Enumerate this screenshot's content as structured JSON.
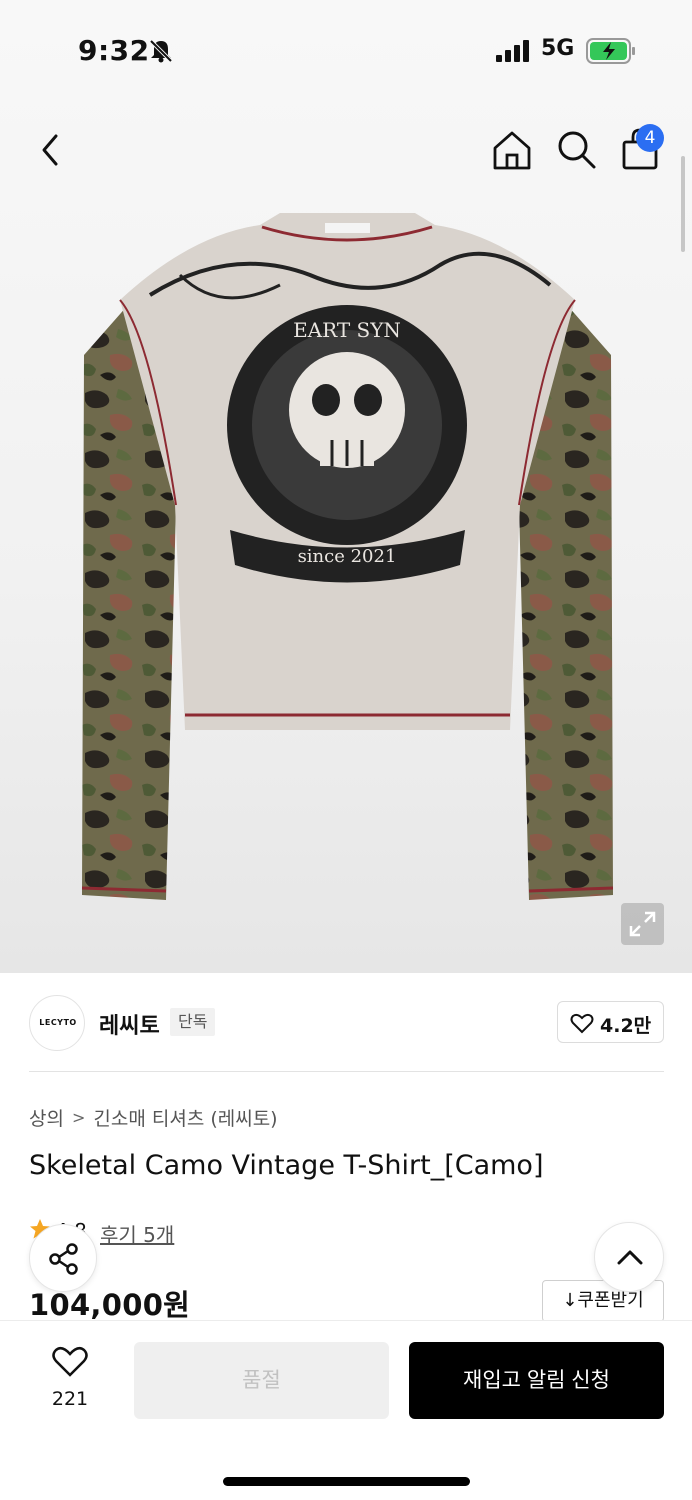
{
  "status": {
    "time": "9:32",
    "network": "5G"
  },
  "header": {
    "cart_count": "4"
  },
  "brand": {
    "logo_text": "LECYTO",
    "name": "레씨토",
    "tag": "단독",
    "likes": "4.2만"
  },
  "breadcrumb": [
    "상의",
    "긴소매 티셔츠 (레씨토)"
  ],
  "product": {
    "title": "Skeletal Camo Vintage T-Shirt_[Camo]",
    "rating": "4.8",
    "reviews": "후기 5개",
    "price": "104,000원",
    "graphic_text_top": "EART SYN",
    "graphic_text_bottom": "since 2021"
  },
  "coupon": {
    "label": "쿠폰받기"
  },
  "bottom": {
    "wish_count": "221",
    "soldout_label": "품절",
    "restock_label": "재입고 알림 신청"
  },
  "colors": {
    "accent": "#2b6ef2",
    "star": "#f5a623",
    "primary_button": "#000000"
  }
}
